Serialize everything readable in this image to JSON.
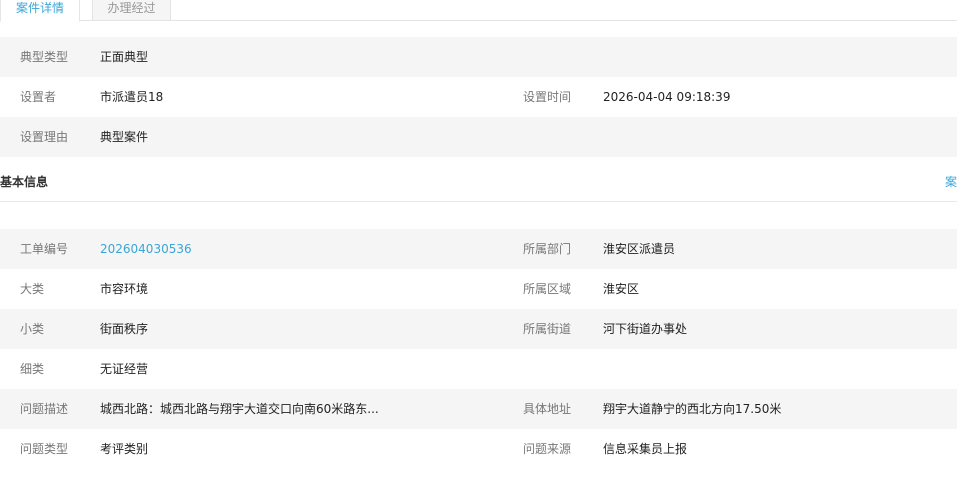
{
  "tabs": {
    "active_label": "案件详情",
    "inactive_label": "办理经过"
  },
  "typical": {
    "type_label": "典型类型",
    "type_value": "正面典型",
    "setter_label": "设置者",
    "setter_value": "市派遣员18",
    "time_label": "设置时间",
    "time_value": "2026-04-04 09:18:39",
    "reason_label": "设置理由",
    "reason_value": "典型案件"
  },
  "basic_info": {
    "title": "基本信息",
    "right_link": "案"
  },
  "details": {
    "order_no_label": "工单编号",
    "order_no_value": "202604030536",
    "department_label": "所属部门",
    "department_value": "淮安区派遣员",
    "category_label": "大类",
    "category_value": "市容环境",
    "region_label": "所属区域",
    "region_value": "淮安区",
    "subcategory_label": "小类",
    "subcategory_value": "街面秩序",
    "street_label": "所属街道",
    "street_value": "河下街道办事处",
    "detail_type_label": "细类",
    "detail_type_value": "无证经营",
    "description_label": "问题描述",
    "description_value": "城西北路：城西北路与翔宇大道交口向南60米路东...",
    "address_label": "具体地址",
    "address_value": "翔宇大道静宁的西北方向17.50米",
    "problem_type_label": "问题类型",
    "problem_type_value": "考评类别",
    "source_label": "问题来源",
    "source_value": "信息采集员上报"
  }
}
